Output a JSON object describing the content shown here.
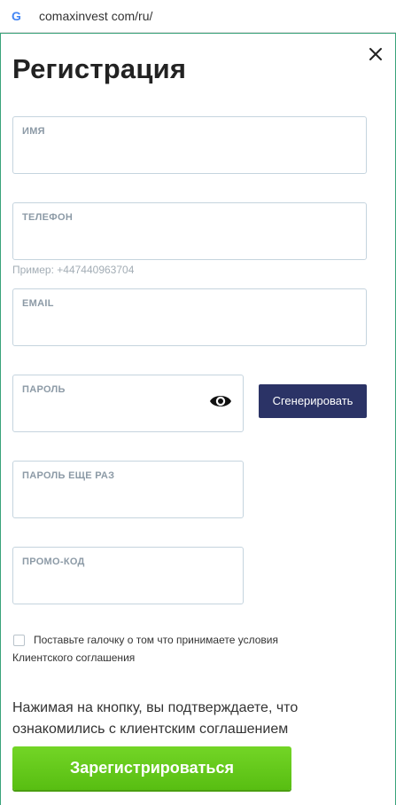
{
  "browser": {
    "logo_letter": "G",
    "url": "comaxinvest com/ru/"
  },
  "modal": {
    "title": "Регистрация",
    "close_icon": "close-icon"
  },
  "fields": {
    "name": {
      "label": "ИМЯ",
      "value": ""
    },
    "phone": {
      "label": "ТЕЛЕФОН",
      "value": "",
      "hint": "Пример: +447440963704"
    },
    "email": {
      "label": "EMAIL",
      "value": ""
    },
    "password": {
      "label": "ПАРОЛЬ",
      "value": "",
      "toggle_icon": "eye-icon"
    },
    "password_repeat": {
      "label": "ПАРОЛЬ ЕЩЕ РАЗ",
      "value": ""
    },
    "promo": {
      "label": "ПРОМО-КОД",
      "value": ""
    }
  },
  "generate_button": "Сгенерировать",
  "agreement": {
    "checked": false,
    "line1": "Поставьте галочку о том что принимаете условия",
    "line2": "Клиентского соглашения"
  },
  "notice": "Нажимая на кнопку, вы подтверждаете, что ознакомились с клиентским соглашением",
  "submit_button": "Зарегистрироваться",
  "colors": {
    "accent_border": "#3aa37a",
    "generate_bg": "#2b3366",
    "submit_bg": "#62c819"
  }
}
